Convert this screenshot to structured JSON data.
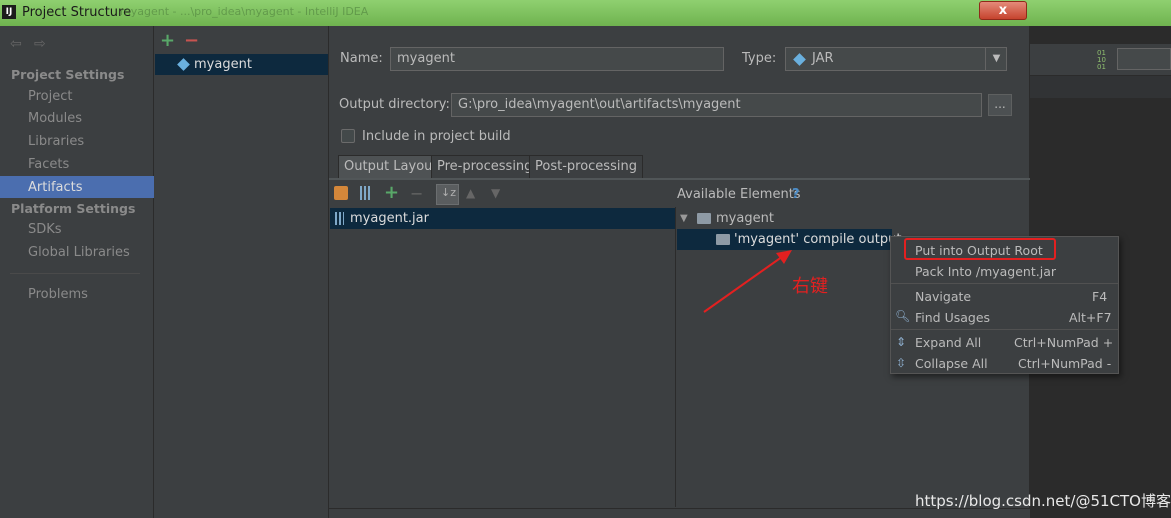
{
  "window": {
    "title": "Project Structure",
    "app_icon": "IJ",
    "close_label": "x",
    "background_title": "myagent - ...\\pro_idea\\myagent - IntelliJ IDEA"
  },
  "sidebar": {
    "project_settings": "Project Settings",
    "project_items": [
      "Project",
      "Modules",
      "Libraries",
      "Facets",
      "Artifacts"
    ],
    "platform_settings": "Platform Settings",
    "platform_items": [
      "SDKs",
      "Global Libraries"
    ],
    "problems": "Problems",
    "selected": "Artifacts"
  },
  "artifacts_list": {
    "add_label": "+",
    "remove_label": "−",
    "items": [
      "myagent"
    ]
  },
  "artifact": {
    "name_label": "Name:",
    "name_value": "myagent",
    "type_label": "Type:",
    "type_value": "JAR",
    "output_dir_label": "Output directory:",
    "output_dir_value": "G:\\pro_idea\\myagent\\out\\artifacts\\myagent",
    "browse_label": "...",
    "include_label": "Include in project build"
  },
  "tabs": [
    "Output Layout",
    "Pre-processing",
    "Post-processing"
  ],
  "layout_tree": {
    "root": "myagent.jar"
  },
  "available": {
    "header": "Available Elements",
    "help": "?",
    "module": "myagent",
    "child": "'myagent' compile output"
  },
  "context_menu": {
    "put_into_root": "Put into Output Root",
    "pack_into": "Pack Into /myagent.jar",
    "navigate": "Navigate",
    "navigate_sc": "F4",
    "find_usages": "Find Usages",
    "find_usages_sc": "Alt+F7",
    "expand_all": "Expand All",
    "expand_all_sc": "Ctrl+NumPad +",
    "collapse_all": "Collapse All",
    "collapse_all_sc": "Ctrl+NumPad -"
  },
  "annotation": "右键",
  "watermark": "https://blog.csdn.net/@51CTO博客",
  "colors": {
    "accent_selection": "#4b6eaf",
    "highlight_red": "#e32020",
    "dark_selection": "#0d293e"
  }
}
